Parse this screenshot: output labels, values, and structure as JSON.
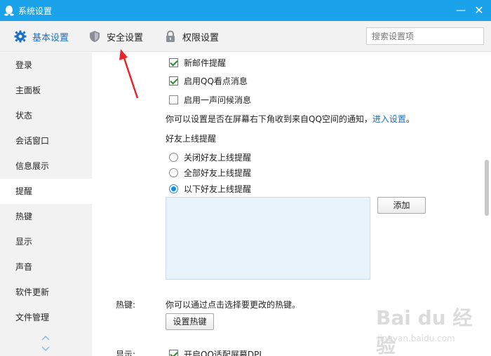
{
  "window": {
    "title": "系统设置",
    "minimize": "—",
    "close": "✕"
  },
  "tabs": [
    {
      "label": "基本设置",
      "icon": "gear-icon",
      "active": true
    },
    {
      "label": "安全设置",
      "icon": "shield-icon",
      "active": false
    },
    {
      "label": "权限设置",
      "icon": "lock-icon",
      "active": false
    }
  ],
  "search": {
    "placeholder": "搜索设置项"
  },
  "sidebar": {
    "items": [
      {
        "label": "登录"
      },
      {
        "label": "主面板"
      },
      {
        "label": "状态"
      },
      {
        "label": "会话窗口"
      },
      {
        "label": "信息展示"
      },
      {
        "label": "提醒",
        "active": true
      },
      {
        "label": "热键"
      },
      {
        "label": "显示"
      },
      {
        "label": "声音"
      },
      {
        "label": "软件更新"
      },
      {
        "label": "文件管理"
      }
    ]
  },
  "content": {
    "mail_checkbox": {
      "label": "新邮件提醒",
      "checked": true
    },
    "qq_checkbox": {
      "label": "启用QQ看点消息",
      "checked": true
    },
    "greet_checkbox": {
      "label": "启用一声问候消息",
      "checked": false
    },
    "notice_text": "你可以设置是否在屏幕右下角收到来自QQ空间的通知，",
    "notice_link": "进入设置",
    "notice_end": "。",
    "friend_section": "好友上线提醒",
    "radios": [
      {
        "label": "关闭好友上线提醒",
        "selected": false
      },
      {
        "label": "全部好友上线提醒",
        "selected": false
      },
      {
        "label": "以下好友上线提醒",
        "selected": true
      }
    ],
    "add_button": "添加",
    "hotkey_label": "热键:",
    "hotkey_text": "你可以通过点击选择要更改的热键。",
    "hotkey_button": "设置热键",
    "display_label": "显示:",
    "dpi_checkbox": {
      "label": "开启QQ适配屏幕DPI",
      "checked": true
    }
  },
  "watermark": {
    "brand": "Bai du 经验",
    "url": "jingyan.baidu.com"
  },
  "colors": {
    "titlebar": "#1aa3ea",
    "accent": "#1a6fc4",
    "annotation": "#e8262a"
  }
}
